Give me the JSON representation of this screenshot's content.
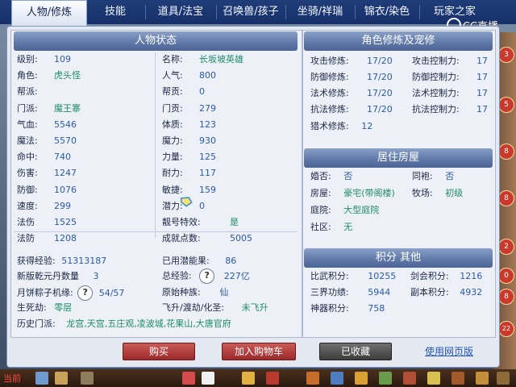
{
  "tabs": [
    {
      "label": "人物/修炼",
      "active": true
    },
    {
      "label": "技能",
      "active": false
    },
    {
      "label": "道具/法宝",
      "active": false
    },
    {
      "label": "召唤兽/孩子",
      "active": false
    },
    {
      "label": "坐骑/祥瑞",
      "active": false
    },
    {
      "label": "锦衣/染色",
      "active": false
    },
    {
      "label": "玩家之家",
      "active": false
    }
  ],
  "watermark": "CC直播",
  "edge_numbers": [
    "3",
    "5",
    "8",
    "8",
    "2",
    "0",
    "8",
    "22"
  ],
  "status": {
    "title": "人物状态",
    "left": [
      {
        "label": "级别:",
        "value": "109"
      },
      {
        "label": "角色:",
        "value": "虎头怪"
      },
      {
        "label": "帮派:",
        "value": ""
      },
      {
        "label": "门派:",
        "value": "魔王寨"
      },
      {
        "label": "气血:",
        "value": "5546"
      },
      {
        "label": "魔法:",
        "value": "5570"
      },
      {
        "label": "命中:",
        "value": "740"
      },
      {
        "label": "伤害:",
        "value": "1247"
      },
      {
        "label": "防御:",
        "value": "1076"
      },
      {
        "label": "速度:",
        "value": "299"
      },
      {
        "label": "法伤",
        "value": "1525"
      },
      {
        "label": "法防",
        "value": "1208"
      }
    ],
    "right": [
      {
        "label": "名称:",
        "value": "长坂坡英雄"
      },
      {
        "label": "人气:",
        "value": "800"
      },
      {
        "label": "帮贡:",
        "value": "0"
      },
      {
        "label": "门贡:",
        "value": "279"
      },
      {
        "label": "体质:",
        "value": "123"
      },
      {
        "label": "魔力:",
        "value": "930"
      },
      {
        "label": "力量:",
        "value": "125"
      },
      {
        "label": "耐力:",
        "value": "117"
      },
      {
        "label": "敏捷:",
        "value": "159"
      },
      {
        "label": "潜力:",
        "value": "0"
      },
      {
        "label": "靓号特效:",
        "value": "是"
      },
      {
        "label": "成就点数:",
        "value": "5005"
      }
    ],
    "exp": {
      "label": "获得经验:",
      "value": "51313187"
    },
    "used_potential": {
      "label": "已用潜能果:",
      "value": "86"
    },
    "qianyuan": {
      "label": "新版乾元丹数量",
      "value": "3"
    },
    "total_exp": {
      "label": "总经验:",
      "value": "227亿"
    },
    "mooncake": {
      "label": "月饼粽子机缘:",
      "value": "54/57"
    },
    "race": {
      "label": "原始种族:",
      "value": "仙"
    },
    "life_death": {
      "label": "生死劫:",
      "value": "零层"
    },
    "ascension": {
      "label": "飞升/渡劫/化圣:",
      "value": "未飞升"
    },
    "history": {
      "label": "历史门派:",
      "value": "龙宫,天宫,五庄观,凌波城,花果山,大唐官府"
    }
  },
  "cultivation": {
    "title": "角色修炼及宠修",
    "rows": [
      {
        "l_label": "攻击修炼:",
        "l_value": "17/20",
        "r_label": "攻击控制力:",
        "r_value": "17"
      },
      {
        "l_label": "防御修炼:",
        "l_value": "17/20",
        "r_label": "防御控制力:",
        "r_value": "17"
      },
      {
        "l_label": "法术修炼:",
        "l_value": "17/20",
        "r_label": "法术控制力:",
        "r_value": "17"
      },
      {
        "l_label": "抗法修炼:",
        "l_value": "17/20",
        "r_label": "抗法控制力:",
        "r_value": "17"
      }
    ],
    "hunt": {
      "label": "猎术修炼:",
      "value": "12"
    }
  },
  "house": {
    "title": "居住房屋",
    "marriage": {
      "label": "婚否:",
      "value": "否"
    },
    "sworn": {
      "label": "同袍:",
      "value": "否"
    },
    "house": {
      "label": "房屋:",
      "value": "豪宅(带阁楼)"
    },
    "ranch": {
      "label": "牧场:",
      "value": "初级"
    },
    "yard": {
      "label": "庭院:",
      "value": "大型庭院"
    },
    "community": {
      "label": "社区:",
      "value": "无"
    }
  },
  "points": {
    "title": "积分 其他",
    "biwu": {
      "label": "比武积分:",
      "value": "10255"
    },
    "jianhui": {
      "label": "剑会积分:",
      "value": "1216"
    },
    "sanjie": {
      "label": "三界功绩:",
      "value": "5944"
    },
    "fuben": {
      "label": "副本积分:",
      "value": "4932"
    },
    "shenqi": {
      "label": "神器积分:",
      "value": "758"
    }
  },
  "buttons": {
    "buy": "购买",
    "cart": "加入购物车",
    "favorited": "已收藏",
    "web": "使用网页版"
  },
  "help_glyph": "?",
  "bottom": {
    "current": "当前"
  },
  "colors": {
    "tab_bar": "#1f3d78",
    "header": "#5e77a6",
    "value": "#2b5aa6",
    "value_green": "#1f8a6e",
    "button_red": "#9b2a2b"
  }
}
